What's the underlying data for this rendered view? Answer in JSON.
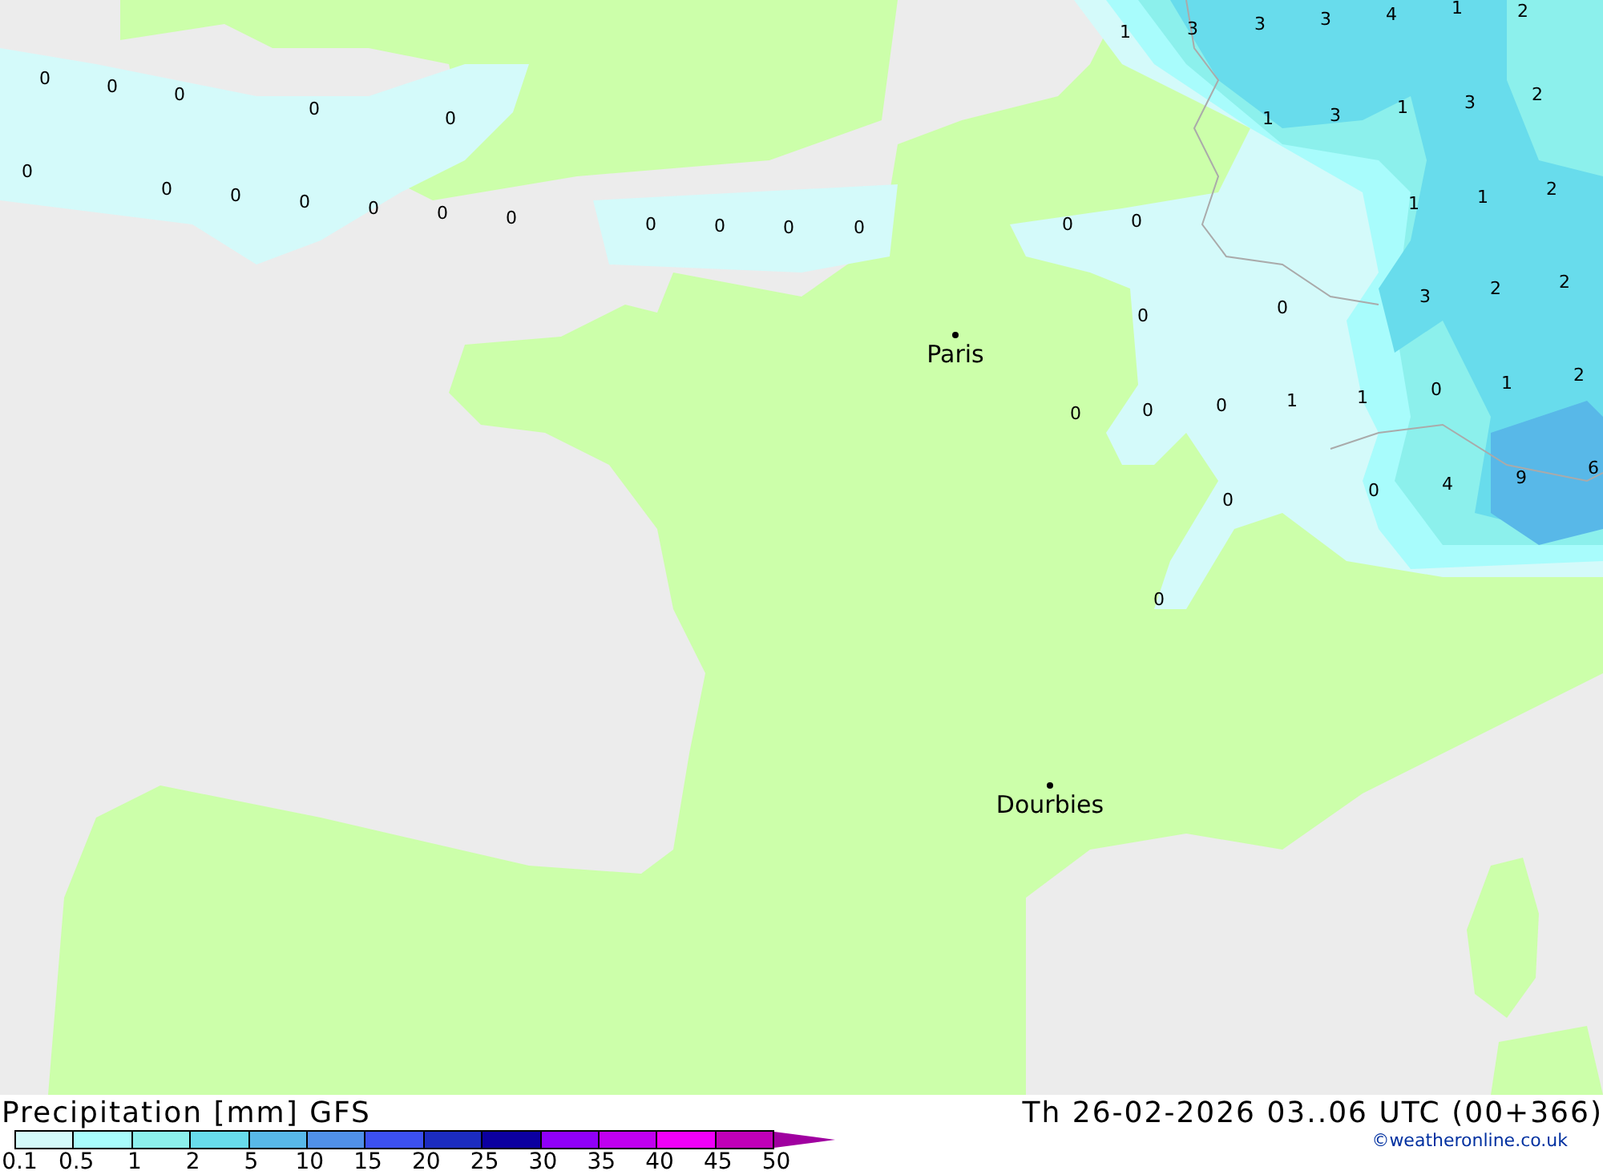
{
  "map": {
    "values": [
      "0",
      "0",
      "0",
      "0",
      "0",
      "0",
      "0",
      "0",
      "0",
      "0",
      "0",
      "0",
      "0",
      "0",
      "0",
      "0",
      "0",
      "0",
      "1",
      "3",
      "3",
      "3",
      "4",
      "1",
      "2",
      "1",
      "3",
      "1",
      "3",
      "2",
      "1",
      "1",
      "2",
      "3",
      "2",
      "2",
      "0",
      "0",
      "1",
      "0",
      "1",
      "2",
      "0",
      "0",
      "0",
      "1",
      "0",
      "0",
      "4",
      "9",
      "6",
      "0"
    ],
    "cities": [
      {
        "name": "Paris"
      },
      {
        "name": "Dourbies"
      }
    ]
  },
  "legend": {
    "title": "Precipitation [mm] GFS",
    "valid_time": "Th 26-02-2026 03..06 UTC (00+366)",
    "credit": "©weatheronline.co.uk",
    "swatches": [
      {
        "color": "#d4fafa"
      },
      {
        "color": "#a8fcfc"
      },
      {
        "color": "#8cf0ec"
      },
      {
        "color": "#68dcec"
      },
      {
        "color": "#58b8e8"
      },
      {
        "color": "#5090e8"
      },
      {
        "color": "#3c50f0"
      },
      {
        "color": "#1c2cc0"
      },
      {
        "color": "#0c00a0"
      },
      {
        "color": "#9000f8"
      },
      {
        "color": "#c000f0"
      },
      {
        "color": "#f000f8"
      },
      {
        "color": "#c000b8"
      }
    ],
    "labels": [
      "0.1",
      "0.5",
      "1",
      "2",
      "5",
      "10",
      "15",
      "20",
      "25",
      "30",
      "35",
      "40",
      "45",
      "50"
    ]
  }
}
